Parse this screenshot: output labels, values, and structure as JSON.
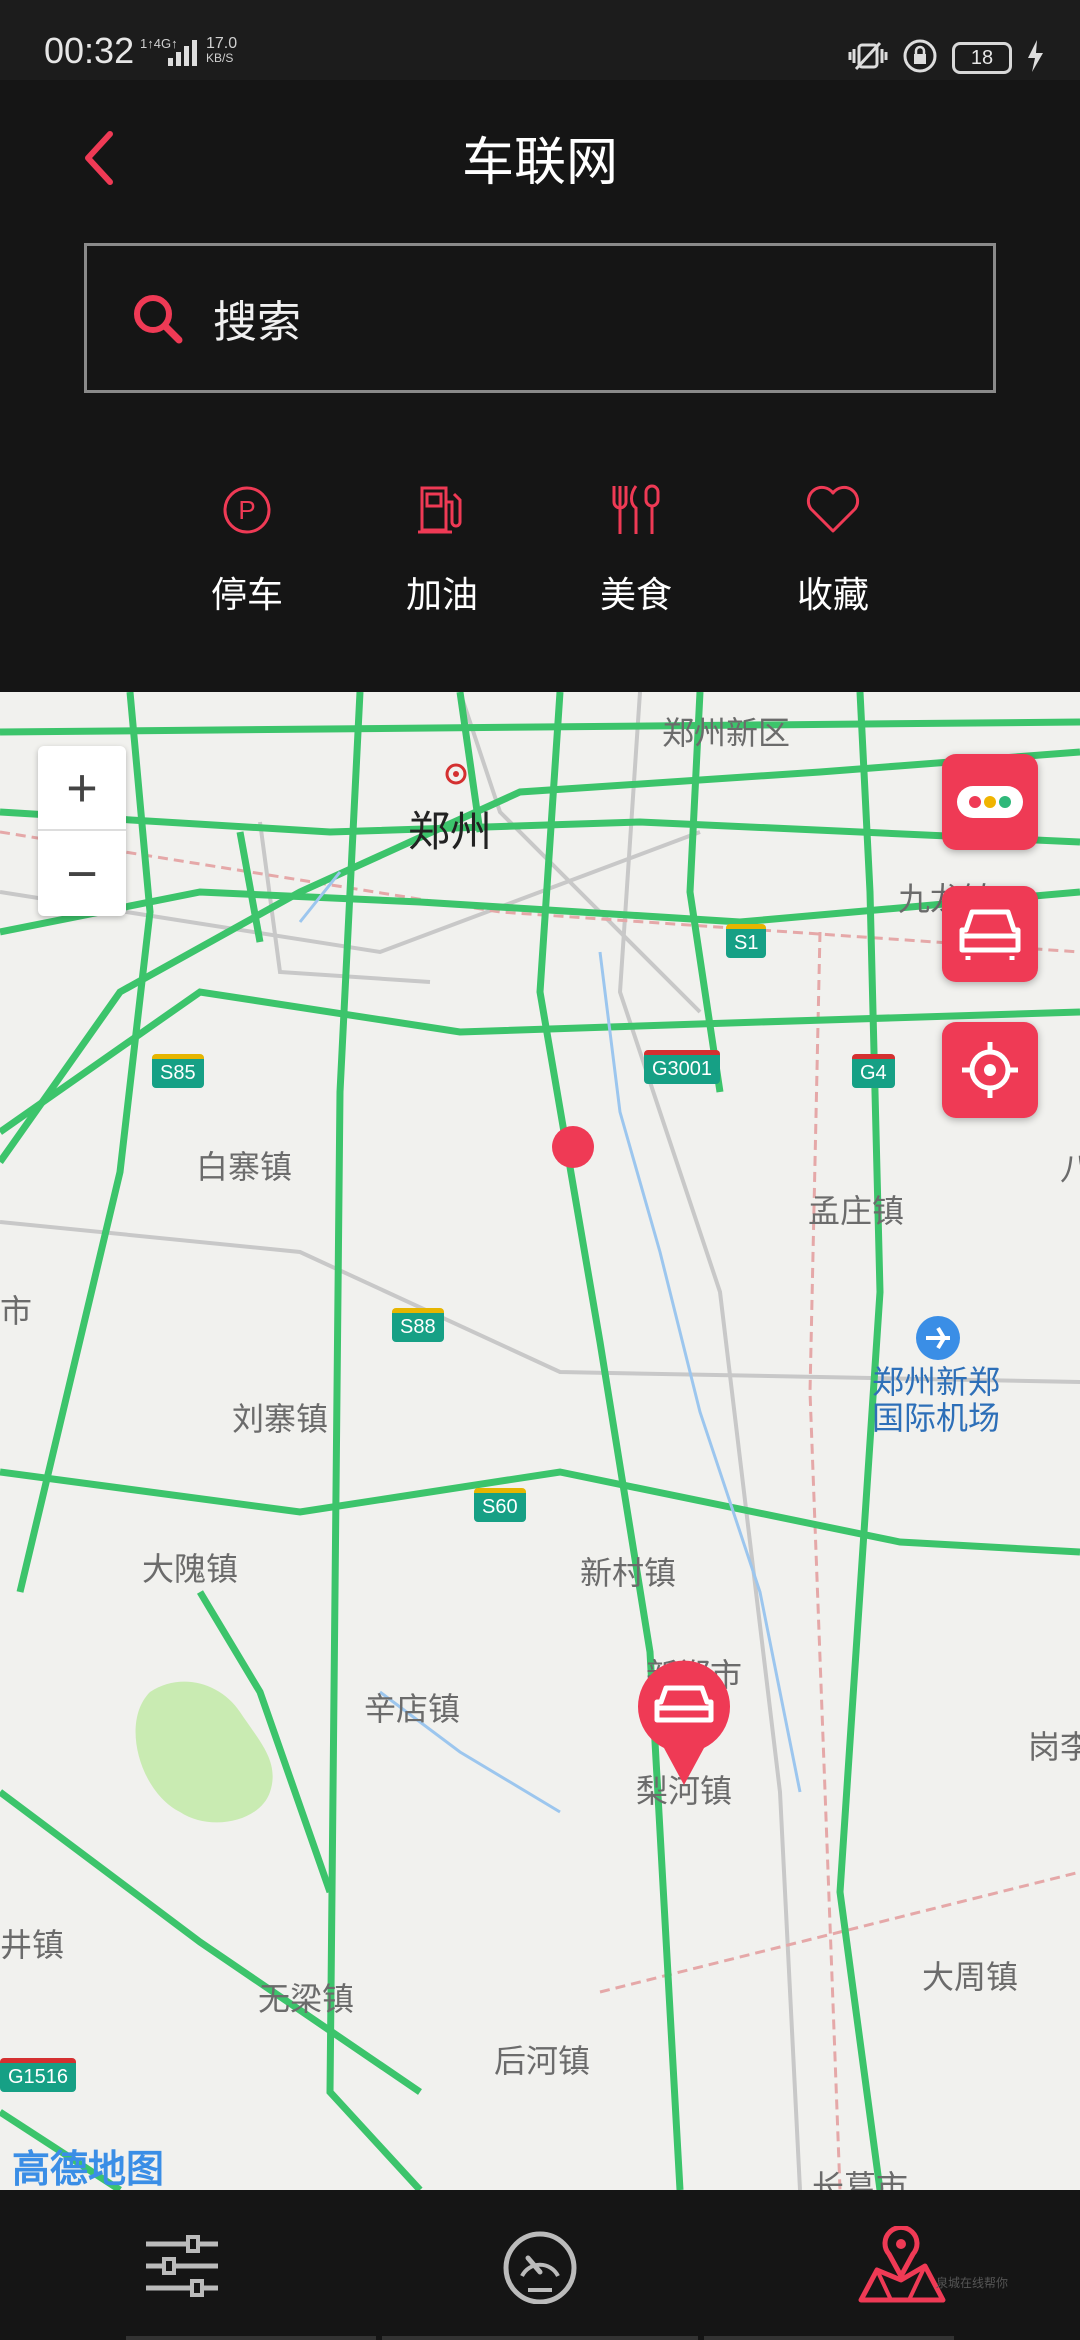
{
  "status_bar": {
    "time": "00:32",
    "network": "1↑4G↑",
    "speed_value": "17.0",
    "speed_unit": "KB/S",
    "battery": "18"
  },
  "header": {
    "title": "车联网"
  },
  "search": {
    "placeholder": "搜索"
  },
  "categories": [
    {
      "label": "停车",
      "icon": "parking-icon"
    },
    {
      "label": "加油",
      "icon": "fuel-pump-icon"
    },
    {
      "label": "美食",
      "icon": "food-icon"
    },
    {
      "label": "收藏",
      "icon": "heart-icon"
    }
  ],
  "map": {
    "places": [
      "郑州新区",
      "郑州",
      "九龙镇",
      "白寨镇",
      "孟庄镇",
      "郑州新郑",
      "国际机场",
      "刘寨镇",
      "大隗镇",
      "新村镇",
      "新郑市",
      "辛店镇",
      "梨河镇",
      "岗李",
      "井镇",
      "无梁镇",
      "后河镇",
      "大周镇",
      "长葛市",
      "八",
      "市"
    ],
    "shields": [
      "S1",
      "S85",
      "G3001",
      "G4",
      "S88",
      "S60",
      "G1516"
    ],
    "zoom_in": "+",
    "zoom_out": "−",
    "provider_logo": "高德地图"
  },
  "bottom_nav": {
    "items": [
      "settings-sliders-icon",
      "speedometer-icon",
      "map-pin-icon"
    ],
    "watermark": "泉城在线帮你"
  },
  "colors": {
    "accent": "#ef3a55",
    "background": "#151515",
    "map_road": "#3cc46b"
  }
}
